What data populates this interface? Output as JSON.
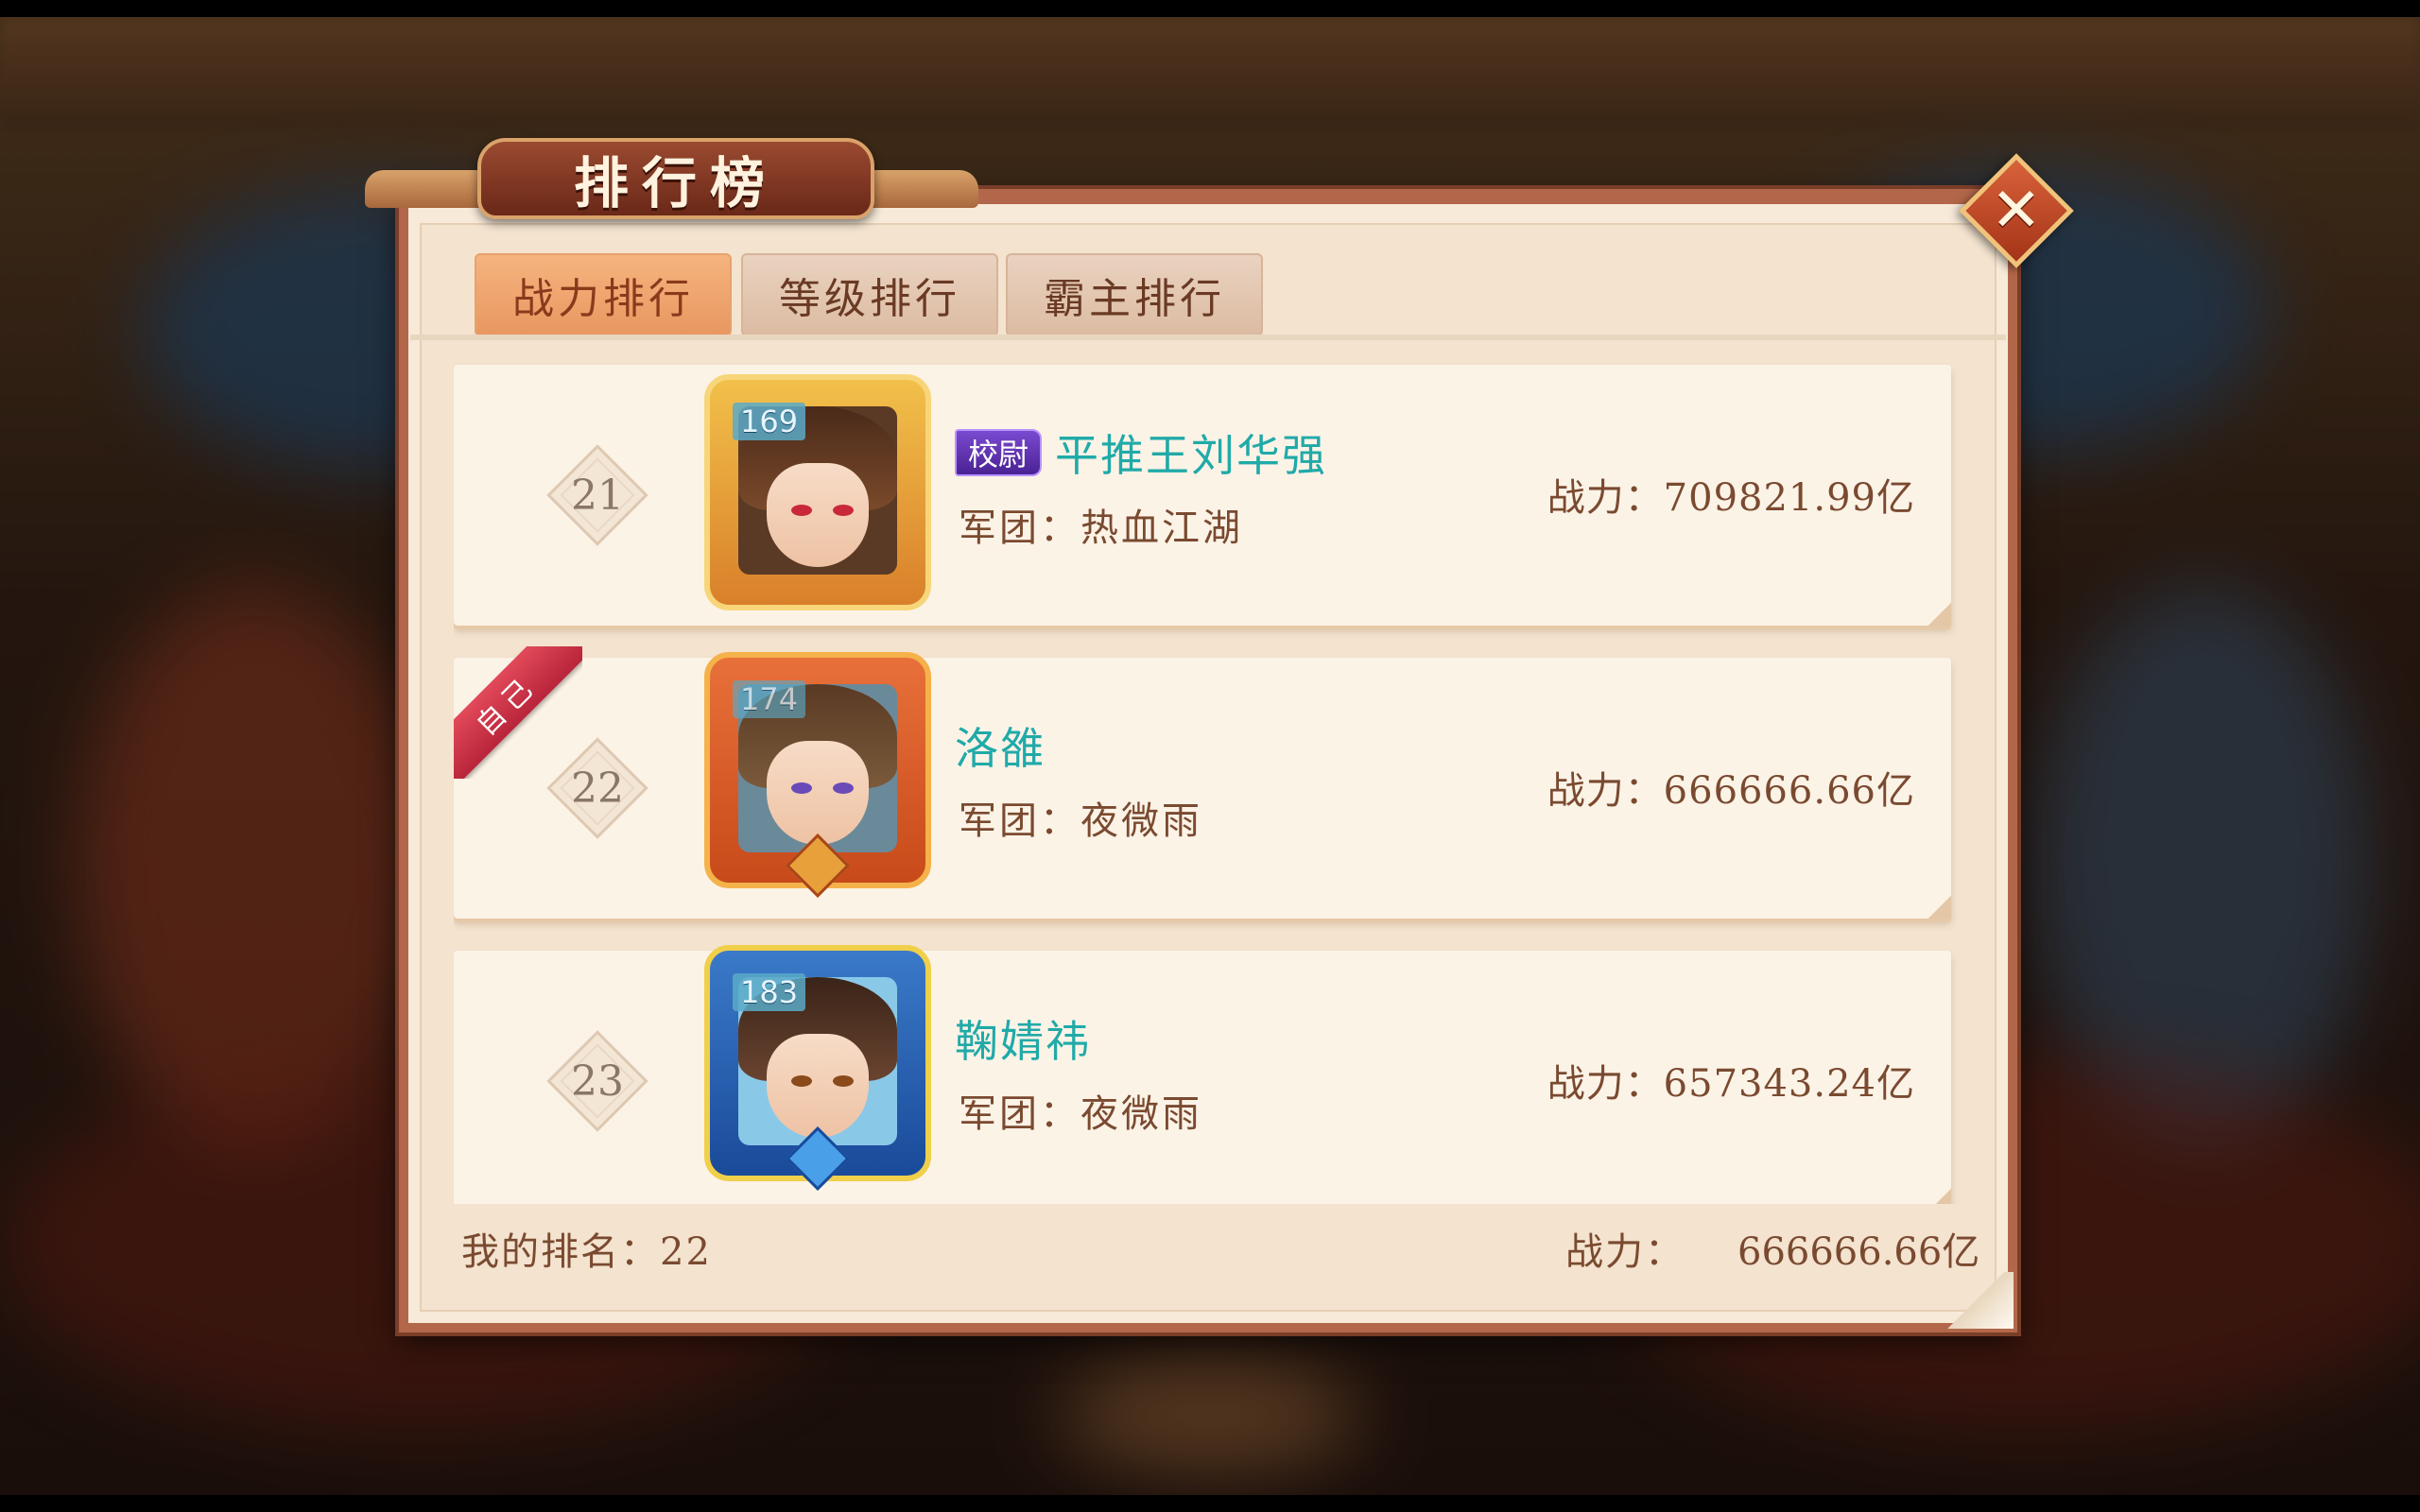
{
  "window": {
    "title": "排行榜"
  },
  "tabs": [
    {
      "label": "战力排行",
      "active": true
    },
    {
      "label": "等级排行",
      "active": false
    },
    {
      "label": "霸主排行",
      "active": false
    }
  ],
  "close_icon": "close-icon",
  "rows": [
    {
      "rank": "21",
      "level": "169",
      "title_badge": "校尉",
      "name": "平推王刘华强",
      "legion": "军团：热血江湖",
      "power": "战力：709821.99亿",
      "is_self": false
    },
    {
      "rank": "22",
      "level": "174",
      "title_badge": "",
      "name": "洛雒",
      "legion": "军团：夜微雨",
      "power": "战力：666666.66亿",
      "is_self": true,
      "self_label": "自己"
    },
    {
      "rank": "23",
      "level": "183",
      "title_badge": "",
      "name": "鞠婧祎",
      "legion": "军团：夜微雨",
      "power": "战力：657343.24亿",
      "is_self": false
    }
  ],
  "footer": {
    "my_rank": "我的排名：22",
    "power_label": "战力：",
    "power_value": "666666.66亿"
  },
  "colors": {
    "accent": "#e89760",
    "name": "#20aaa8",
    "text": "#7a4a30",
    "frame": "#b3674a"
  }
}
